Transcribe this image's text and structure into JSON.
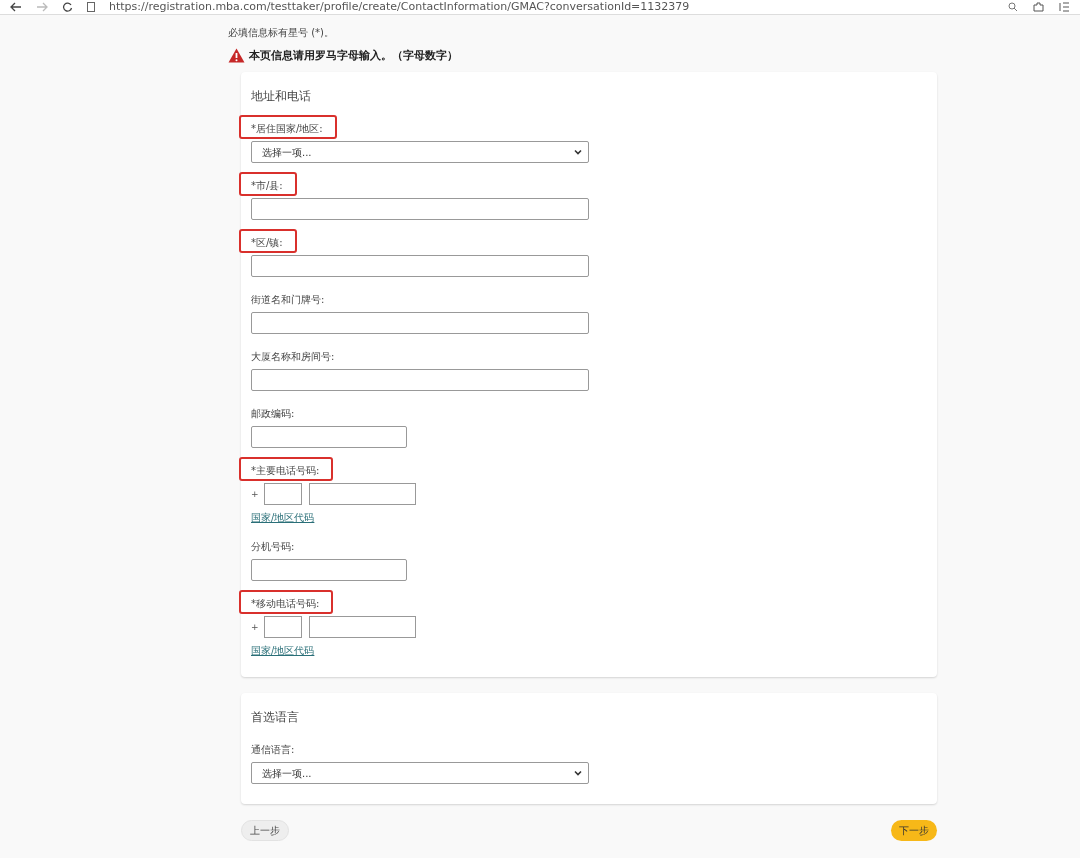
{
  "browser": {
    "url": "https://registration.mba.com/testtaker/profile/create/ContactInformation/GMAC?conversationId=1132379"
  },
  "required_note": "必填信息标有星号 (*)。",
  "warning": "本页信息请用罗马字母输入。（字母数字）",
  "sections": [
    {
      "title": "地址和电话",
      "fields": [
        {
          "kind": "select",
          "label": "*居住国家/地区:",
          "highlighted": true,
          "value": "选择一项..."
        },
        {
          "kind": "text",
          "label": "*市/县:",
          "highlighted": true
        },
        {
          "kind": "text",
          "label": "*区/镇:",
          "highlighted": true
        },
        {
          "kind": "text",
          "label": "街道名和门牌号:",
          "highlighted": false
        },
        {
          "kind": "text",
          "label": "大厦名称和房间号:",
          "highlighted": false
        },
        {
          "kind": "short_text",
          "label": "邮政编码:",
          "highlighted": false
        },
        {
          "kind": "phone",
          "label": "*主要电话号码:",
          "highlighted": true,
          "prefix": "+",
          "link": "国家/地区代码"
        },
        {
          "kind": "short_text",
          "label": "分机号码:",
          "highlighted": false
        },
        {
          "kind": "phone",
          "label": "*移动电话号码:",
          "highlighted": true,
          "prefix": "+",
          "link": "国家/地区代码"
        }
      ]
    },
    {
      "title": "首选语言",
      "fields": [
        {
          "kind": "select",
          "label": "通信语言:",
          "highlighted": false,
          "value": "选择一项..."
        }
      ]
    }
  ],
  "buttons": [
    {
      "kind": "secondary",
      "label": "上一步"
    },
    {
      "kind": "primary",
      "label": "下一步"
    }
  ]
}
